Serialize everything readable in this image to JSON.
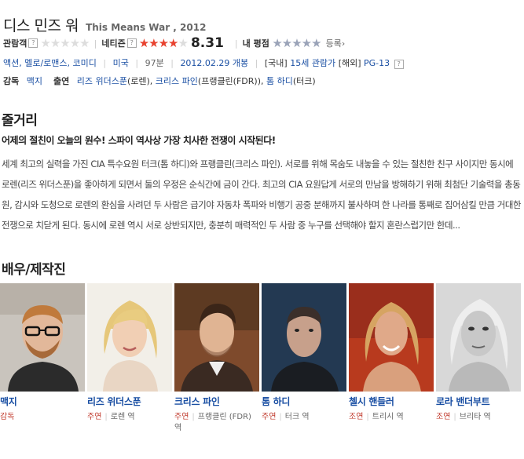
{
  "movie": {
    "title_ko": "디스 민즈 워",
    "title_en": "This Means War , 2012"
  },
  "ratings": {
    "audience_label": "관람객",
    "audience_stars": 0,
    "netizen_label": "네티즌",
    "netizen_stars": 4,
    "netizen_score": "8.31",
    "mine_label": "내 평점",
    "register_label": "등록›"
  },
  "info": {
    "genres": "액션, 멜로/로맨스, 코미디",
    "country": "미국",
    "runtime": "97분",
    "release": "2012.02.29 개봉",
    "domestic_tag": "[국내]",
    "domestic_rating": "15세 관람가",
    "overseas_tag": "[해외]",
    "overseas_rating": "PG-13",
    "q": "?"
  },
  "credits": {
    "director_label": "감독",
    "director": "맥지",
    "cast_label": "출연",
    "actor1": "리즈 위더스푼",
    "actor1_role": "(로렌)",
    "actor2": "크리스 파인",
    "actor2_role": "(프랭클린(FDR))",
    "actor3": "톰 하디",
    "actor3_role": "(터크)"
  },
  "synopsis": {
    "heading": "줄거리",
    "tagline": "어제의 절친이 오늘의 원수! 스파이 역사상 가장 치사한 전쟁이 시작된다!",
    "body": "세계 최고의 실력을 가진 CIA 특수요원 터크(톰 하디)와 프랭클린(크리스 파인). 서로를 위해 목숨도 내놓을 수 있는 절친한 친구 사이지만 동시에 로렌(리즈 위더스푼)을 좋아하게 되면서 둘의 우정은 순식간에 금이 간다. 최고의 CIA 요원답게 서로의 만남을 방해하기 위해 최첨단 기술력을 총동원, 감시와 도청으로 로렌의 환심을 사려던 두 사람은 급기야 자동차 폭파와 비행기 공중 분해까지 불사하며 한 나라를 통째로 집어삼킬 만큼 거대한 전쟁으로 치닫게 된다. 동시에 로렌 역시 서로 상반되지만, 충분히 매력적인 두 사람 중 누구를 선택해야 할지 혼란스럽기만 한데..."
  },
  "crew": {
    "heading": "배우/제작진",
    "people": [
      {
        "name": "맥지",
        "kind": "감독",
        "role": "",
        "icon": "portrait-icon"
      },
      {
        "name": "리즈 위더스푼",
        "kind": "주연",
        "role": "로렌 역",
        "icon": "portrait-icon"
      },
      {
        "name": "크리스 파인",
        "kind": "주연",
        "role": "프랭클린 (FDR) 역",
        "icon": "portrait-icon"
      },
      {
        "name": "톰 하디",
        "kind": "주연",
        "role": "터크 역",
        "icon": "portrait-icon"
      },
      {
        "name": "첼시 핸들러",
        "kind": "조연",
        "role": "트리시 역",
        "icon": "portrait-icon"
      },
      {
        "name": "로라 밴더부트",
        "kind": "조연",
        "role": "브리타 역",
        "icon": "portrait-icon"
      }
    ]
  },
  "colors": {
    "link": "#1a4fa3",
    "star_active": "#e8422f",
    "role_kind": "#c0392b"
  }
}
